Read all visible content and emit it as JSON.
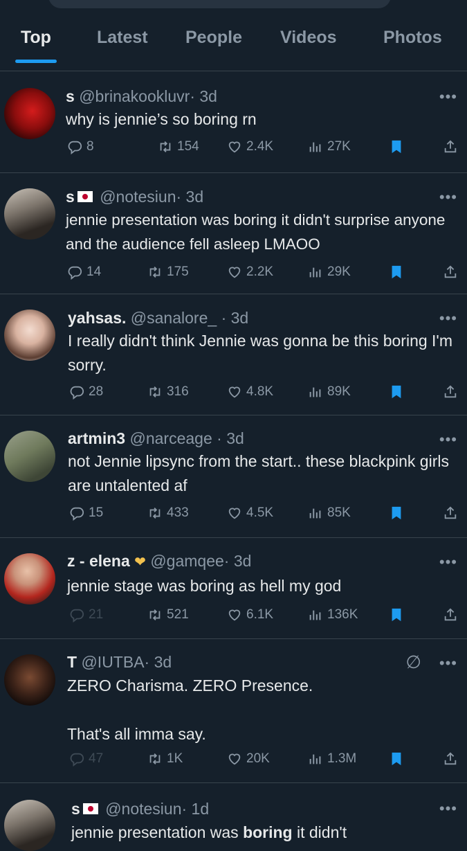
{
  "tabs": [
    {
      "label": "Top",
      "active": true
    },
    {
      "label": "Latest",
      "active": false
    },
    {
      "label": "People",
      "active": false
    },
    {
      "label": "Videos",
      "active": false
    },
    {
      "label": "Photos",
      "active": false
    }
  ],
  "tweets": [
    {
      "name": "s",
      "handle": "@brinakookluvr",
      "time": "· 3d",
      "text": "why is jennie’s so boring rn",
      "replies": "8",
      "reposts": "154",
      "likes": "2.4K",
      "views": "27K"
    },
    {
      "name": "s",
      "handle": "@notesiun",
      "time": "· 3d",
      "text": "jennie presentation was boring it didn't surprise anyone and the audience fell asleep LMAOO",
      "replies": "14",
      "reposts": "175",
      "likes": "2.2K",
      "views": "29K"
    },
    {
      "name": "yahsas.",
      "handle": "@sanalore_",
      "time": "· 3d",
      "text": "I really didn't think Jennie was gonna be this boring I'm sorry.",
      "replies": "28",
      "reposts": "316",
      "likes": "4.8K",
      "views": "89K"
    },
    {
      "name": "artmin3",
      "handle": "@narceage",
      "time": "· 3d",
      "text": "not Jennie lipsync from the start.. these blackpink girls are untalented af",
      "replies": "15",
      "reposts": "433",
      "likes": "4.5K",
      "views": "85K"
    },
    {
      "name": "z - elena",
      "handle": "@gamqee",
      "time": "· 3d",
      "text": "jennie stage was boring as hell my god",
      "replies": "21",
      "reposts": "521",
      "likes": "6.1K",
      "views": "136K"
    },
    {
      "name": "T",
      "handle": "@IUTBA",
      "time": "· 3d",
      "text": "ZERO Charisma. ZERO Presence.\n\nThat's all imma say.",
      "replies": "47",
      "reposts": "1K",
      "likes": "20K",
      "views": "1.3M"
    },
    {
      "name": "s",
      "handle": "@notesiun",
      "time": "· 1d",
      "text_before": "jennie presentation was ",
      "text_bold": "boring",
      "text_after": " it didn't"
    }
  ],
  "more_label": "•••",
  "colors": {
    "background": "#15202b",
    "accent": "#1d9bf0",
    "secondary_text": "#8b98a5",
    "divider": "#38444d"
  },
  "icons": [
    "reply-icon",
    "repost-icon",
    "like-icon",
    "views-icon",
    "bookmark-icon",
    "share-icon",
    "more-icon",
    "grok-icon"
  ]
}
